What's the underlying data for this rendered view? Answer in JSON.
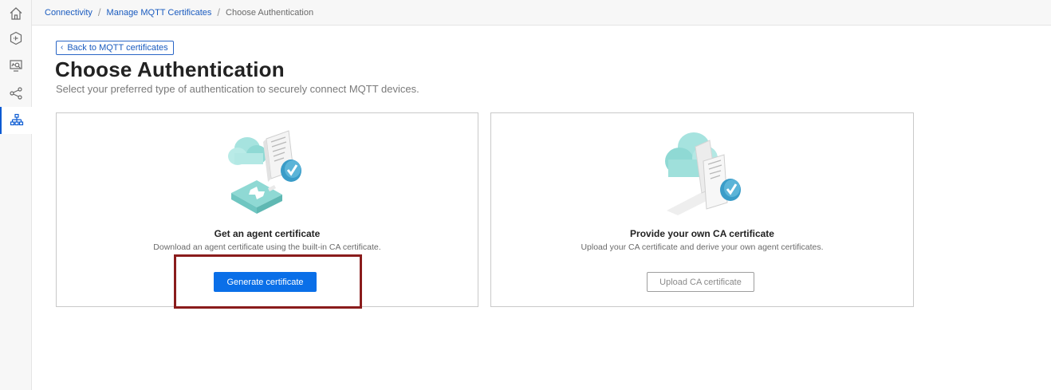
{
  "breadcrumb": {
    "items": [
      "Connectivity",
      "Manage MQTT Certificates"
    ],
    "current": "Choose Authentication"
  },
  "nav": {
    "icons": [
      "home-icon",
      "data-flow-icon",
      "monitor-search-icon",
      "share-icon",
      "hierarchy-icon"
    ],
    "active": "hierarchy-icon"
  },
  "page": {
    "back_label": "Back to MQTT certificates",
    "title": "Choose Authentication",
    "subtitle": "Select your preferred type of authentication to securely connect MQTT devices."
  },
  "cards": [
    {
      "title": "Get an agent certificate",
      "description": "Download an agent certificate using the built-in CA certificate.",
      "button": "Generate certificate"
    },
    {
      "title": "Provide your own CA certificate",
      "description": "Upload your CA certificate and derive your own agent certificates.",
      "button": "Upload CA certificate"
    }
  ],
  "colors": {
    "accent": "#0a6fe8",
    "link": "#1a5bbf",
    "highlight": "#8a1c1c",
    "illustration_teal": "#8fdad6",
    "illustration_badge": "#3a9cc8"
  }
}
